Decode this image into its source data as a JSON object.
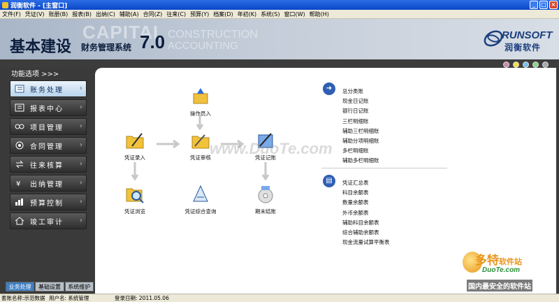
{
  "window": {
    "title": "润衡软件 - [主窗口]"
  },
  "menu": [
    "文件(F)",
    "凭证(V)",
    "账册(B)",
    "报表(B)",
    "出纳(C)",
    "辅助(A)",
    "合同(Z)",
    "往来(C)",
    "预算(Y)",
    "档案(D)",
    "年初(K)",
    "系统(S)",
    "窗口(W)",
    "帮助(H)"
  ],
  "banner": {
    "title": "基本建设",
    "subtitle": "财务管理系统",
    "version": "7.0",
    "bg_word1": "CAPITAL",
    "bg_word2": "CONSTRUCTION",
    "bg_word3": "ACCOUNTING",
    "brand": "RUNSOFT",
    "brand_cn": "润衡软件"
  },
  "sidebar": {
    "header": "功能选项 >>>",
    "items": [
      {
        "label": "账务处理",
        "icon": "ledger-icon",
        "active": true
      },
      {
        "label": "报表中心",
        "icon": "report-icon",
        "active": false
      },
      {
        "label": "项目管理",
        "icon": "project-icon",
        "active": false
      },
      {
        "label": "合同管理",
        "icon": "contract-icon",
        "active": false
      },
      {
        "label": "往来核算",
        "icon": "exchange-icon",
        "active": false
      },
      {
        "label": "出纳管理",
        "icon": "cashier-icon",
        "active": false
      },
      {
        "label": "预算控制",
        "icon": "budget-icon",
        "active": false
      },
      {
        "label": "竣工审计",
        "icon": "house-icon",
        "active": false
      }
    ],
    "tabs": [
      "业务处理",
      "基础设置",
      "系统维护"
    ]
  },
  "dot_colors": [
    "#c98bb0",
    "#f2e04a",
    "#7cc0e8",
    "#8cd08a",
    "#a8a8a8"
  ],
  "flow": {
    "operator_login": "操作员入",
    "voucher_entry": "凭证录入",
    "voucher_review": "凭证审核",
    "voucher_posting": "凭证记账",
    "voucher_browse": "凭证浏览",
    "voucher_query": "凭证综合查询",
    "period_close": "期末结账"
  },
  "ledgers": [
    "总分类账",
    "现金日记账",
    "银行日记账",
    "三栏明细账",
    "辅助三栏明细账",
    "辅助分项明细账",
    "多栏明细账",
    "辅助多栏明细账"
  ],
  "balances": [
    "凭证汇总表",
    "科目余额表",
    "数量余额表",
    "外币余额表",
    "辅助科目余额表",
    "综合辅助余额表",
    "现金流量试算平衡表"
  ],
  "watermarks": {
    "center": "www.DuoTe.com",
    "logo_cn": "多特",
    "logo_suffix": "软件站",
    "logo_en": "DuoTe.com",
    "slogan": "国内最安全的软件站"
  },
  "status": {
    "account": "套账名称:示范数据",
    "user": "用户名: 系统管理",
    "login_date": "登录日期: 2011.05.06"
  }
}
